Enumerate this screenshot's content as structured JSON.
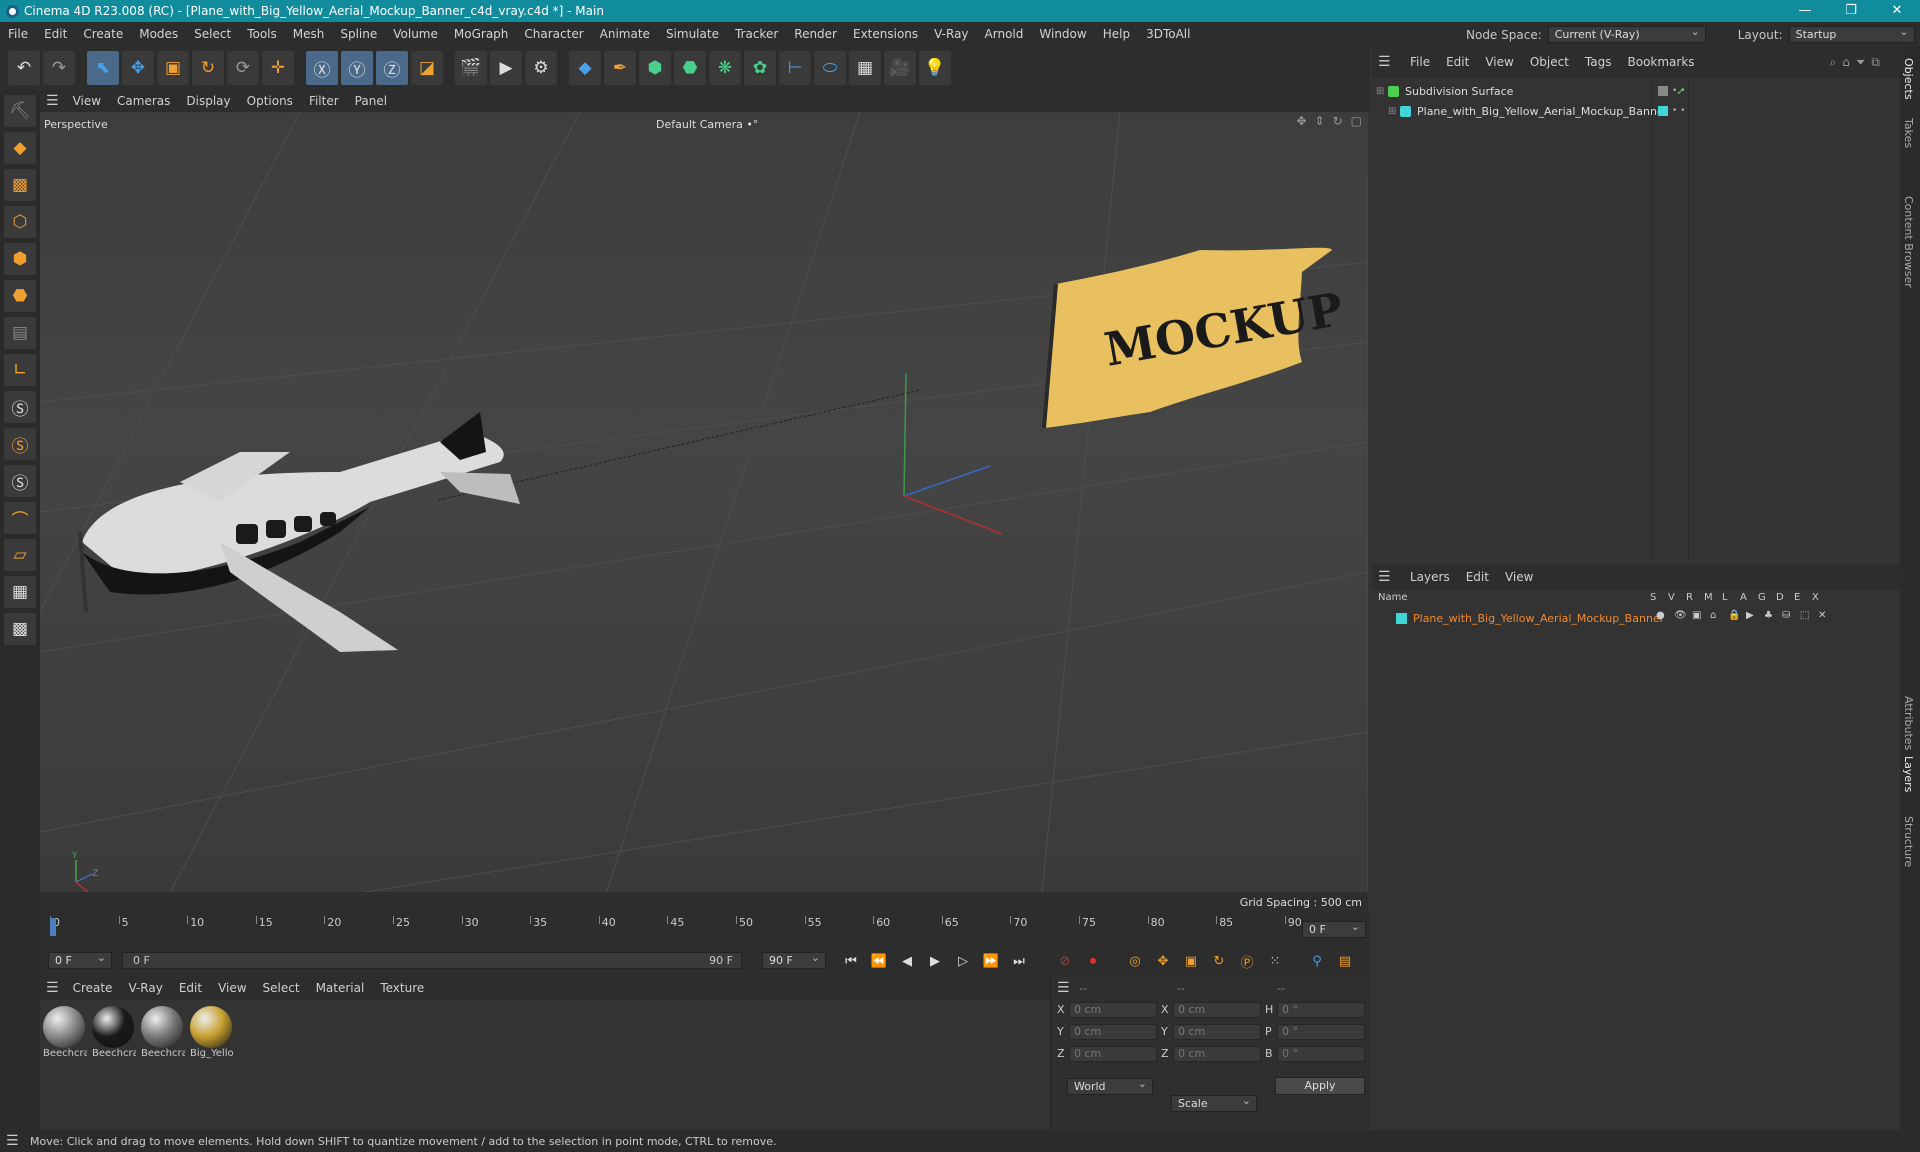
{
  "window": {
    "title": "Cinema 4D R23.008 (RC) - [Plane_with_Big_Yellow_Aerial_Mockup_Banner_c4d_vray.c4d *] - Main",
    "controls": [
      "—",
      "❐",
      "✕"
    ]
  },
  "menubar": {
    "items": [
      "File",
      "Edit",
      "Create",
      "Modes",
      "Select",
      "Tools",
      "Mesh",
      "Spline",
      "Volume",
      "MoGraph",
      "Character",
      "Animate",
      "Simulate",
      "Tracker",
      "Render",
      "Extensions",
      "V-Ray",
      "Arnold",
      "Window",
      "Help",
      "3DToAll"
    ],
    "node_space_label": "Node Space:",
    "node_space_value": "Current (V-Ray)",
    "layout_label": "Layout:",
    "layout_value": "Startup"
  },
  "viewport": {
    "menu": [
      "View",
      "Cameras",
      "Display",
      "Options",
      "Filter",
      "Panel"
    ],
    "label": "Perspective",
    "camera": "Default Camera",
    "camera_icon": "•°",
    "grid_spacing": "Grid Spacing : 500 cm",
    "banner_text": "MOCKUP"
  },
  "timeline": {
    "ticks": [
      "0",
      "5",
      "10",
      "15",
      "20",
      "25",
      "30",
      "35",
      "40",
      "45",
      "50",
      "55",
      "60",
      "65",
      "70",
      "75",
      "80",
      "85",
      "90"
    ],
    "current_frame": "0 F"
  },
  "transport": {
    "start": "0 F",
    "range_start": "0 F",
    "range_end": "90 F",
    "end": "90 F"
  },
  "materials": {
    "menu": [
      "Create",
      "V-Ray",
      "Edit",
      "View",
      "Select",
      "Material",
      "Texture"
    ],
    "items": [
      {
        "name": "Beechcra",
        "color": "#8a8a8a"
      },
      {
        "name": "Beechcra",
        "color": "#1a1a1a"
      },
      {
        "name": "Beechcra",
        "color": "#7a7a7a"
      },
      {
        "name": "Big_Yello",
        "color": "#c8a030"
      }
    ]
  },
  "coordinates": {
    "headers": [
      "--",
      "--",
      "--"
    ],
    "rows": [
      {
        "a": "X",
        "av": "0 cm",
        "b": "X",
        "bv": "0 cm",
        "c": "H",
        "cv": "0 °"
      },
      {
        "a": "Y",
        "av": "0 cm",
        "b": "Y",
        "bv": "0 cm",
        "c": "P",
        "cv": "0 °"
      },
      {
        "a": "Z",
        "av": "0 cm",
        "b": "Z",
        "bv": "0 cm",
        "c": "B",
        "cv": "0 °"
      }
    ],
    "mode": "World",
    "scale": "Scale",
    "apply": "Apply"
  },
  "objects": {
    "menu": [
      "File",
      "Edit",
      "View",
      "Object",
      "Tags",
      "Bookmarks"
    ],
    "items": [
      {
        "name": "Subdivision Surface",
        "color": "#4ad04a"
      },
      {
        "name": "Plane_with_Big_Yellow_Aerial_Mockup_Banner",
        "color": "#3ed6d6"
      }
    ]
  },
  "layers": {
    "menu": [
      "Layers",
      "Edit",
      "View"
    ],
    "columns": [
      "Name",
      "S",
      "V",
      "R",
      "M",
      "L",
      "A",
      "G",
      "D",
      "E",
      "X"
    ],
    "items": [
      {
        "name": "Plane_with_Big_Yellow_Aerial_Mockup_Banner",
        "color": "#3ed6d6",
        "text_color": "#f08a30"
      }
    ]
  },
  "right_tabs": [
    "Objects",
    "Takes",
    "Content Browser",
    "Attributes",
    "Layers",
    "Structure"
  ],
  "status": "Move: Click and drag to move elements. Hold down SHIFT to quantize movement / add to the selection in point mode, CTRL to remove.",
  "colors": {
    "title_bar": "#108c9c",
    "accent_orange": "#f0a030",
    "banner_yellow": "#e8c060"
  }
}
